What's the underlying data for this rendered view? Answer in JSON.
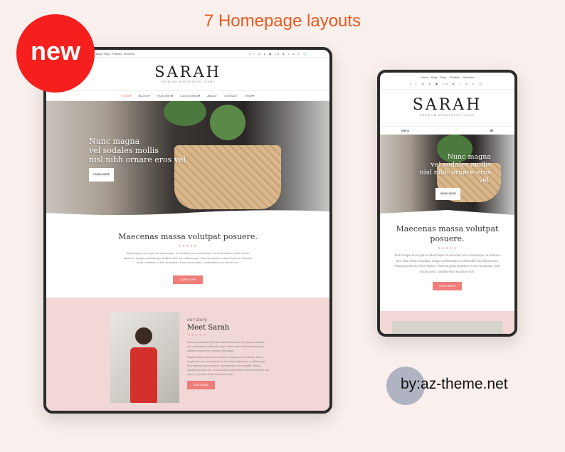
{
  "headline": "7 Homepage layouts",
  "badge": "new",
  "credit": "by:az-theme.net",
  "colors": {
    "accent": "#ea5a22",
    "badge": "#f51f1d",
    "button": "#ef7e7a",
    "pink_section": "#f1d7d6"
  },
  "site": {
    "top_links": [
      "Home",
      "Blog",
      "Shop",
      "Portfolio",
      "Services"
    ],
    "social_icons": [
      "facebook-icon",
      "twitter-icon",
      "instagram-icon",
      "pinterest-icon",
      "youtube-icon",
      "linkedin-icon",
      "flickr-icon",
      "tiktok-icon",
      "vimeo-icon",
      "search-icon",
      "cart-icon"
    ],
    "logo": "SARAH",
    "tagline": "PREMIUM WORDPRESS THEME",
    "nav": [
      "HOME▾",
      "BLOGS▾",
      "FEATURES▾",
      "CATEGORIES▾",
      "ABOUT",
      "CONTACT",
      "SHOP▾"
    ],
    "menu_label": "Menu",
    "hero": {
      "line1": "Nunc magna",
      "line2": "vel sodales mollis",
      "line3": "nisl nibh ornare eros vel.",
      "button": "LEARN MORE"
    },
    "intro": {
      "title": "Maecenas massa volutpat posuere.",
      "stars": "★★★★★",
      "text": "Duis congue arcu eget mi ullamcorper, eu tincidunt arcu scelerisque. In vehicula arcu vitae dictum faucibus. Integer pellentesque facilisis nibh non ullamcorper. Vivamus porta eu nisl et lacinia. Vivamus porta maximus ex sed accumsan. Duis mauris justo, condimentum eu ipsum non.",
      "button": "LEARN MORE"
    },
    "story": {
      "kicker": "our story",
      "title": "Meet Sarah",
      "stars": "★★★★★",
      "p1": "Maecenas aliquam, felis vitae blandit bibendum, odio justo scelerisque orci, pellentesque sollicitudin augue lorem a sem. Maecenas est justo, ultrices at lacinia non, tempus vitae augue.",
      "p2": "Aliquam finibus dui at dolor tincidunt, at gravida leo venenatis. Donec feugiat felis sem, id commodo lectus tristique bibendum. In ullamcorper nibh maximus urna hendrerit, vitae interdum eros convallis. Mauris egestas imperdiet nisl, id accumsan lectus laoreet et. Aliquam tempus orci ipsum, eu pretium dolor hendrerit sit amet.",
      "button": "READ MORE"
    }
  }
}
